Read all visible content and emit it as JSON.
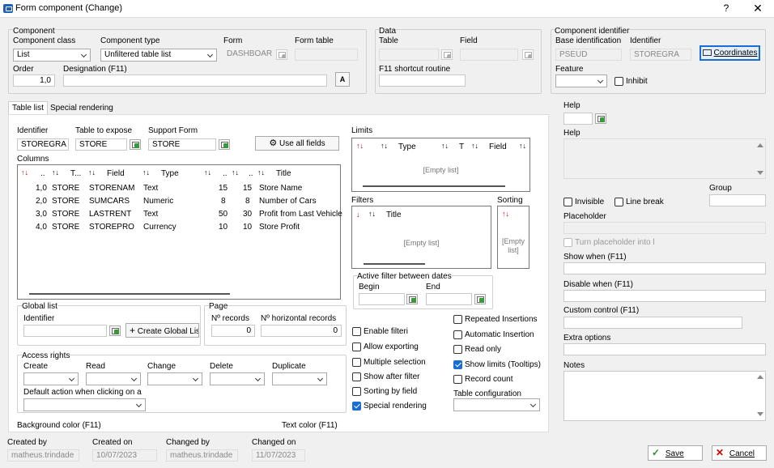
{
  "window": {
    "title": "Form component (Change)",
    "help": "?",
    "close": "✕"
  },
  "component": {
    "group_label": "Component",
    "class_label": "Component class",
    "class_value": "List",
    "type_label": "Component type",
    "type_value": "Unfiltered table list",
    "form_label": "Form",
    "form_value": "DASHBOARD",
    "form_table_label": "Form table",
    "form_table_value": "",
    "order_label": "Order",
    "order_value": "1,0",
    "designation_label": "Designation (F11)",
    "designation_value": ""
  },
  "data_group": {
    "group_label": "Data",
    "table_label": "Table",
    "table_value": "",
    "field_label": "Field",
    "field_value": "",
    "f11_label": "F11 shortcut routine",
    "f11_value": ""
  },
  "identifier_group": {
    "group_label": "Component identifier",
    "base_label": "Base identification",
    "base_value": "PSEUD",
    "identifier_label": "Identifier",
    "identifier_value": "STOREGRA",
    "coordinates_label": "Coordinates",
    "feature_label": "Feature",
    "feature_value": "",
    "inhibit_label": "Inhibit"
  },
  "tabs": [
    "Table list",
    "Special rendering"
  ],
  "table_list": {
    "identifier_label": "Identifier",
    "identifier_value": "STOREGRA",
    "table_expose_label": "Table to expose",
    "table_expose_value": "STORE",
    "support_form_label": "Support Form",
    "support_form_value": "STORE",
    "use_all_fields_label": "Use all fields",
    "columns_label": "Columns",
    "columns_headers": [
      "..",
      "T...",
      "Field",
      "Type",
      "..",
      "..",
      "Title"
    ],
    "columns_rows": [
      [
        "1,0",
        "STORE",
        "STORENAM",
        "Text",
        "15",
        "15",
        "Store Name"
      ],
      [
        "2,0",
        "STORE",
        "SUMCARS",
        "Numeric",
        "8",
        "8",
        "Number of Cars"
      ],
      [
        "3,0",
        "STORE",
        "LASTRENT",
        "Text",
        "50",
        "30",
        "Profit from Last Vehicle"
      ],
      [
        "4,0",
        "STORE",
        "STOREPRO",
        "Currency",
        "10",
        "10",
        "Store Profit"
      ]
    ],
    "limits_label": "Limits",
    "limits_headers": [
      "Type",
      "T",
      "Field"
    ],
    "limits_empty": "[Empty list]",
    "filters_label": "Filters",
    "filters_header": "Title",
    "filters_empty": "[Empty list]",
    "sorting_label": "Sorting",
    "sorting_empty_1": "[Empty",
    "sorting_empty_2": "list]",
    "active_filter_label": "Active filter between dates",
    "begin_label": "Begin",
    "begin_value": "",
    "end_label": "End",
    "end_value": "",
    "global_list_label": "Global list",
    "global_identifier_label": "Identifier",
    "global_identifier_value": "",
    "create_global_label": "Create Global Lis",
    "page_label": "Page",
    "n_records_label": "Nº records",
    "n_records_value": "0",
    "n_horizontal_label": "Nº horizontal records",
    "n_horizontal_value": "0",
    "access_label": "Access rights",
    "create_label": "Create",
    "read_label": "Read",
    "change_label": "Change",
    "delete_label": "Delete",
    "duplicate_label": "Duplicate",
    "default_action_label": "Default action when clicking on a",
    "options_left": [
      {
        "label": "Enable filteri",
        "checked": false
      },
      {
        "label": "Allow exporting",
        "checked": false
      },
      {
        "label": "Multiple selection",
        "checked": false
      },
      {
        "label": "Show after filter",
        "checked": false
      },
      {
        "label": "Sorting by field",
        "checked": false
      },
      {
        "label": "Special rendering",
        "checked": true
      }
    ],
    "options_right": [
      {
        "label": "Repeated Insertions",
        "checked": false
      },
      {
        "label": "Automatic Insertion",
        "checked": false
      },
      {
        "label": "Read only",
        "checked": false
      },
      {
        "label": "Show limits (Tooltips)",
        "checked": true
      },
      {
        "label": "Record count",
        "checked": false
      }
    ],
    "table_config_label": "Table configuration",
    "bg_color_label": "Background color (F11)",
    "text_color_label": "Text color (F11)"
  },
  "right_panel": {
    "help_label": "Help",
    "help_value": "",
    "help2_label": "Help",
    "invisible_label": "Invisible",
    "line_break_label": "Line break",
    "group_label": "Group",
    "group_value": "",
    "placeholder_label": "Placeholder",
    "placeholder_toggle_label": "Turn placeholder into l",
    "show_when_label": "Show when (F11)",
    "disable_when_label": "Disable when (F11)",
    "custom_control_label": "Custom control (F11)",
    "extra_options_label": "Extra options",
    "notes_label": "Notes"
  },
  "footer": {
    "created_by_label": "Created by",
    "created_by_value": "matheus.trindade",
    "created_on_label": "Created on",
    "created_on_value": "10/07/2023",
    "changed_by_label": "Changed by",
    "changed_by_value": "matheus.trindade",
    "changed_on_label": "Changed on",
    "changed_on_value": "11/07/2023",
    "save_label": "Save",
    "cancel_label": "Cancel"
  },
  "colors": {
    "accent": "#1a6dd4",
    "sort_red": "#cc0000",
    "save_green": "#2e8b2e",
    "cancel_red": "#cc0000"
  }
}
